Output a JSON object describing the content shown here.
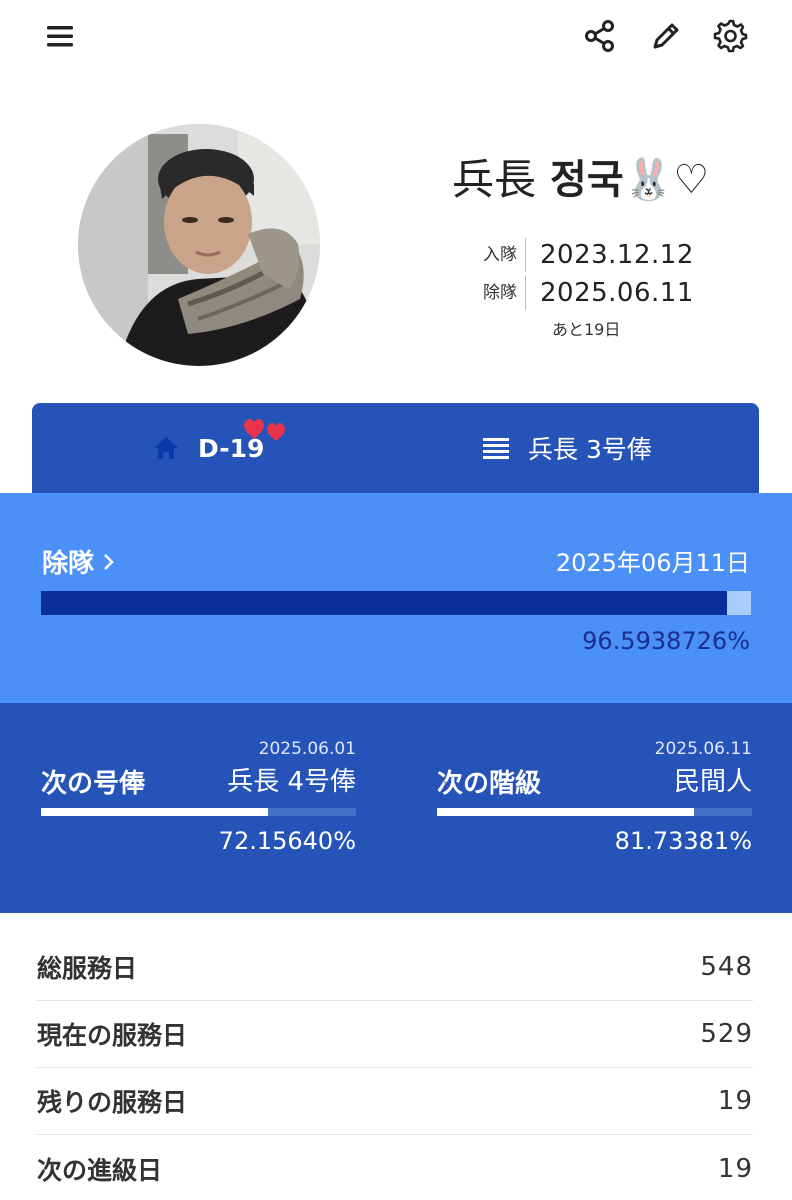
{
  "profile": {
    "rank": "兵長",
    "name": "정국🐰♡",
    "enlist_label": "入隊",
    "enlist_date": "2023.12.12",
    "discharge_label": "除隊",
    "discharge_date": "2025.06.11",
    "remaining_text": "あと19日"
  },
  "tabs": [
    {
      "label": "D-19",
      "icon": "home-icon"
    },
    {
      "label": "兵長 3号俸",
      "icon": "list-icon"
    }
  ],
  "discharge_progress": {
    "title": "除隊",
    "date": "2025年06月11日",
    "percent_text": "96.5938726%",
    "fraction": 0.965938726
  },
  "next_pay": {
    "title": "次の号俸",
    "date": "2025.06.01",
    "target": "兵長 4号俸",
    "percent_text": "72.15640%",
    "fraction": 0.721564
  },
  "next_rank": {
    "title": "次の階級",
    "date": "2025.06.11",
    "target": "民間人",
    "percent_text": "81.73381%",
    "fraction": 0.8173381
  },
  "stats": [
    {
      "label": "総服務日",
      "value": "548"
    },
    {
      "label": "現在の服務日",
      "value": "529"
    },
    {
      "label": "残りの服務日",
      "value": "19"
    },
    {
      "label": "次の進級日",
      "value": "19"
    }
  ],
  "colors": {
    "tab_bg": "#2553b8",
    "progress_bg": "#4a90f7",
    "progress_fill": "#0a2f99",
    "home_icon": "#0a3aa8"
  }
}
